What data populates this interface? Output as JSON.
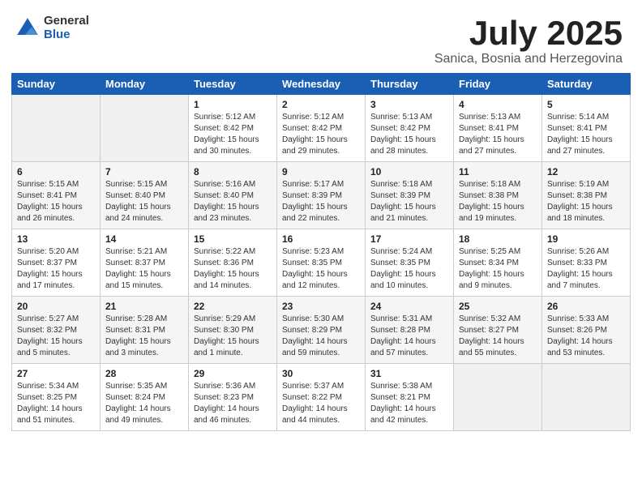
{
  "header": {
    "logo_general": "General",
    "logo_blue": "Blue",
    "month_title": "July 2025",
    "subtitle": "Sanica, Bosnia and Herzegovina"
  },
  "days_of_week": [
    "Sunday",
    "Monday",
    "Tuesday",
    "Wednesday",
    "Thursday",
    "Friday",
    "Saturday"
  ],
  "weeks": [
    [
      {
        "num": "",
        "sunrise": "",
        "sunset": "",
        "daylight": "",
        "empty": true
      },
      {
        "num": "",
        "sunrise": "",
        "sunset": "",
        "daylight": "",
        "empty": true
      },
      {
        "num": "1",
        "sunrise": "Sunrise: 5:12 AM",
        "sunset": "Sunset: 8:42 PM",
        "daylight": "Daylight: 15 hours and 30 minutes."
      },
      {
        "num": "2",
        "sunrise": "Sunrise: 5:12 AM",
        "sunset": "Sunset: 8:42 PM",
        "daylight": "Daylight: 15 hours and 29 minutes."
      },
      {
        "num": "3",
        "sunrise": "Sunrise: 5:13 AM",
        "sunset": "Sunset: 8:42 PM",
        "daylight": "Daylight: 15 hours and 28 minutes."
      },
      {
        "num": "4",
        "sunrise": "Sunrise: 5:13 AM",
        "sunset": "Sunset: 8:41 PM",
        "daylight": "Daylight: 15 hours and 27 minutes."
      },
      {
        "num": "5",
        "sunrise": "Sunrise: 5:14 AM",
        "sunset": "Sunset: 8:41 PM",
        "daylight": "Daylight: 15 hours and 27 minutes."
      }
    ],
    [
      {
        "num": "6",
        "sunrise": "Sunrise: 5:15 AM",
        "sunset": "Sunset: 8:41 PM",
        "daylight": "Daylight: 15 hours and 26 minutes."
      },
      {
        "num": "7",
        "sunrise": "Sunrise: 5:15 AM",
        "sunset": "Sunset: 8:40 PM",
        "daylight": "Daylight: 15 hours and 24 minutes."
      },
      {
        "num": "8",
        "sunrise": "Sunrise: 5:16 AM",
        "sunset": "Sunset: 8:40 PM",
        "daylight": "Daylight: 15 hours and 23 minutes."
      },
      {
        "num": "9",
        "sunrise": "Sunrise: 5:17 AM",
        "sunset": "Sunset: 8:39 PM",
        "daylight": "Daylight: 15 hours and 22 minutes."
      },
      {
        "num": "10",
        "sunrise": "Sunrise: 5:18 AM",
        "sunset": "Sunset: 8:39 PM",
        "daylight": "Daylight: 15 hours and 21 minutes."
      },
      {
        "num": "11",
        "sunrise": "Sunrise: 5:18 AM",
        "sunset": "Sunset: 8:38 PM",
        "daylight": "Daylight: 15 hours and 19 minutes."
      },
      {
        "num": "12",
        "sunrise": "Sunrise: 5:19 AM",
        "sunset": "Sunset: 8:38 PM",
        "daylight": "Daylight: 15 hours and 18 minutes."
      }
    ],
    [
      {
        "num": "13",
        "sunrise": "Sunrise: 5:20 AM",
        "sunset": "Sunset: 8:37 PM",
        "daylight": "Daylight: 15 hours and 17 minutes."
      },
      {
        "num": "14",
        "sunrise": "Sunrise: 5:21 AM",
        "sunset": "Sunset: 8:37 PM",
        "daylight": "Daylight: 15 hours and 15 minutes."
      },
      {
        "num": "15",
        "sunrise": "Sunrise: 5:22 AM",
        "sunset": "Sunset: 8:36 PM",
        "daylight": "Daylight: 15 hours and 14 minutes."
      },
      {
        "num": "16",
        "sunrise": "Sunrise: 5:23 AM",
        "sunset": "Sunset: 8:35 PM",
        "daylight": "Daylight: 15 hours and 12 minutes."
      },
      {
        "num": "17",
        "sunrise": "Sunrise: 5:24 AM",
        "sunset": "Sunset: 8:35 PM",
        "daylight": "Daylight: 15 hours and 10 minutes."
      },
      {
        "num": "18",
        "sunrise": "Sunrise: 5:25 AM",
        "sunset": "Sunset: 8:34 PM",
        "daylight": "Daylight: 15 hours and 9 minutes."
      },
      {
        "num": "19",
        "sunrise": "Sunrise: 5:26 AM",
        "sunset": "Sunset: 8:33 PM",
        "daylight": "Daylight: 15 hours and 7 minutes."
      }
    ],
    [
      {
        "num": "20",
        "sunrise": "Sunrise: 5:27 AM",
        "sunset": "Sunset: 8:32 PM",
        "daylight": "Daylight: 15 hours and 5 minutes."
      },
      {
        "num": "21",
        "sunrise": "Sunrise: 5:28 AM",
        "sunset": "Sunset: 8:31 PM",
        "daylight": "Daylight: 15 hours and 3 minutes."
      },
      {
        "num": "22",
        "sunrise": "Sunrise: 5:29 AM",
        "sunset": "Sunset: 8:30 PM",
        "daylight": "Daylight: 15 hours and 1 minute."
      },
      {
        "num": "23",
        "sunrise": "Sunrise: 5:30 AM",
        "sunset": "Sunset: 8:29 PM",
        "daylight": "Daylight: 14 hours and 59 minutes."
      },
      {
        "num": "24",
        "sunrise": "Sunrise: 5:31 AM",
        "sunset": "Sunset: 8:28 PM",
        "daylight": "Daylight: 14 hours and 57 minutes."
      },
      {
        "num": "25",
        "sunrise": "Sunrise: 5:32 AM",
        "sunset": "Sunset: 8:27 PM",
        "daylight": "Daylight: 14 hours and 55 minutes."
      },
      {
        "num": "26",
        "sunrise": "Sunrise: 5:33 AM",
        "sunset": "Sunset: 8:26 PM",
        "daylight": "Daylight: 14 hours and 53 minutes."
      }
    ],
    [
      {
        "num": "27",
        "sunrise": "Sunrise: 5:34 AM",
        "sunset": "Sunset: 8:25 PM",
        "daylight": "Daylight: 14 hours and 51 minutes."
      },
      {
        "num": "28",
        "sunrise": "Sunrise: 5:35 AM",
        "sunset": "Sunset: 8:24 PM",
        "daylight": "Daylight: 14 hours and 49 minutes."
      },
      {
        "num": "29",
        "sunrise": "Sunrise: 5:36 AM",
        "sunset": "Sunset: 8:23 PM",
        "daylight": "Daylight: 14 hours and 46 minutes."
      },
      {
        "num": "30",
        "sunrise": "Sunrise: 5:37 AM",
        "sunset": "Sunset: 8:22 PM",
        "daylight": "Daylight: 14 hours and 44 minutes."
      },
      {
        "num": "31",
        "sunrise": "Sunrise: 5:38 AM",
        "sunset": "Sunset: 8:21 PM",
        "daylight": "Daylight: 14 hours and 42 minutes."
      },
      {
        "num": "",
        "sunrise": "",
        "sunset": "",
        "daylight": "",
        "empty": true
      },
      {
        "num": "",
        "sunrise": "",
        "sunset": "",
        "daylight": "",
        "empty": true
      }
    ]
  ]
}
